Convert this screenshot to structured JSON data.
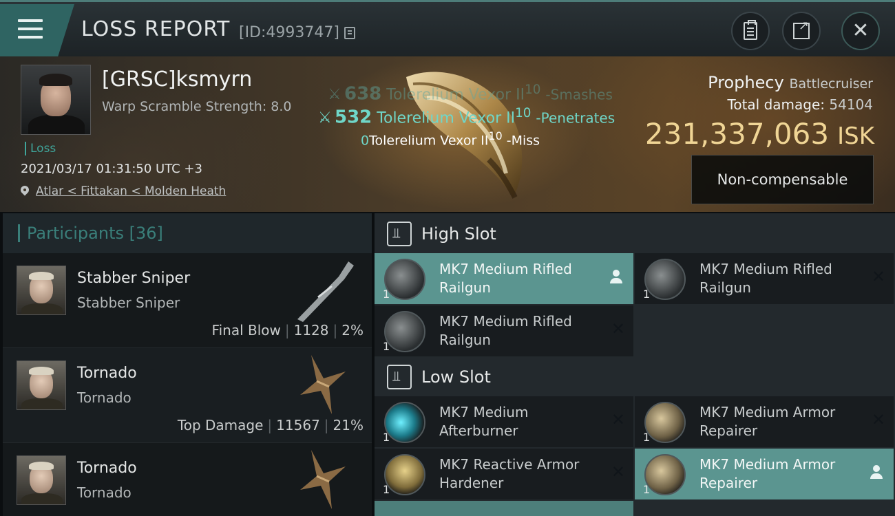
{
  "header": {
    "title": "LOSS REPORT",
    "report_id": "[ID:4993747]",
    "icons": [
      "menu-icon",
      "copy-icon",
      "clipboard-icon",
      "share-icon",
      "close-icon"
    ]
  },
  "victim": {
    "name": "[GRSC]ksmyrn",
    "warp_scramble": "Warp Scramble Strength: 8.0",
    "loss_label": "Loss",
    "datetime": "2021/03/17 01:31:50 UTC +3",
    "location": "Atlar < Fittakan < Molden Heath"
  },
  "damage_feed": [
    {
      "amount": "638",
      "text": "Tolerelium Vexor II",
      "sup": "10",
      "result": "-Smashes"
    },
    {
      "amount": "532",
      "text": "Tolerelium Vexor II",
      "sup": "10",
      "result": "-Penetrates"
    },
    {
      "amount": "0",
      "text": "Tolerelium Vexor II",
      "sup": "10",
      "result": "-Miss"
    }
  ],
  "ship": {
    "name": "Prophecy",
    "class": "Battlecruiser",
    "total_damage_label": "Total damage:",
    "total_damage": "54104",
    "isk_value": "231,337,063",
    "isk_unit": "ISK",
    "compensation": "Non-compensable"
  },
  "participants": {
    "label": "Participants",
    "count": "[36]",
    "rows": [
      {
        "ship": "Stabber Sniper",
        "pilot": "Stabber Sniper",
        "tag": "Final Blow",
        "damage": "1128",
        "percent": "2%"
      },
      {
        "ship": "Tornado",
        "pilot": "Tornado",
        "tag": "Top Damage",
        "damage": "11567",
        "percent": "21%"
      },
      {
        "ship": "Tornado",
        "pilot": "Tornado",
        "tag": "",
        "damage": "",
        "percent": ""
      }
    ]
  },
  "fitting": {
    "high_slot_label": "High Slot",
    "low_slot_label": "Low Slot",
    "high": [
      {
        "name": "MK7 Medium Rifled Railgun",
        "qty": "1",
        "state": "user"
      },
      {
        "name": "MK7 Medium Rifled Railgun",
        "qty": "1",
        "state": "destroyed"
      },
      {
        "name": "MK7 Medium Rifled Railgun",
        "qty": "1",
        "state": "destroyed"
      }
    ],
    "low": [
      {
        "name": "MK7 Medium Afterburner",
        "qty": "1",
        "state": "destroyed"
      },
      {
        "name": "MK7 Medium Armor Repairer",
        "qty": "1",
        "state": "destroyed"
      },
      {
        "name": "MK7 Reactive Armor Hardener",
        "qty": "1",
        "state": "destroyed"
      },
      {
        "name": "MK7 Medium Armor Repairer",
        "qty": "1",
        "state": "user"
      }
    ]
  },
  "colors": {
    "accent": "#3a7f7a",
    "isk": "#f0d595",
    "active_module": "#5b9590"
  }
}
